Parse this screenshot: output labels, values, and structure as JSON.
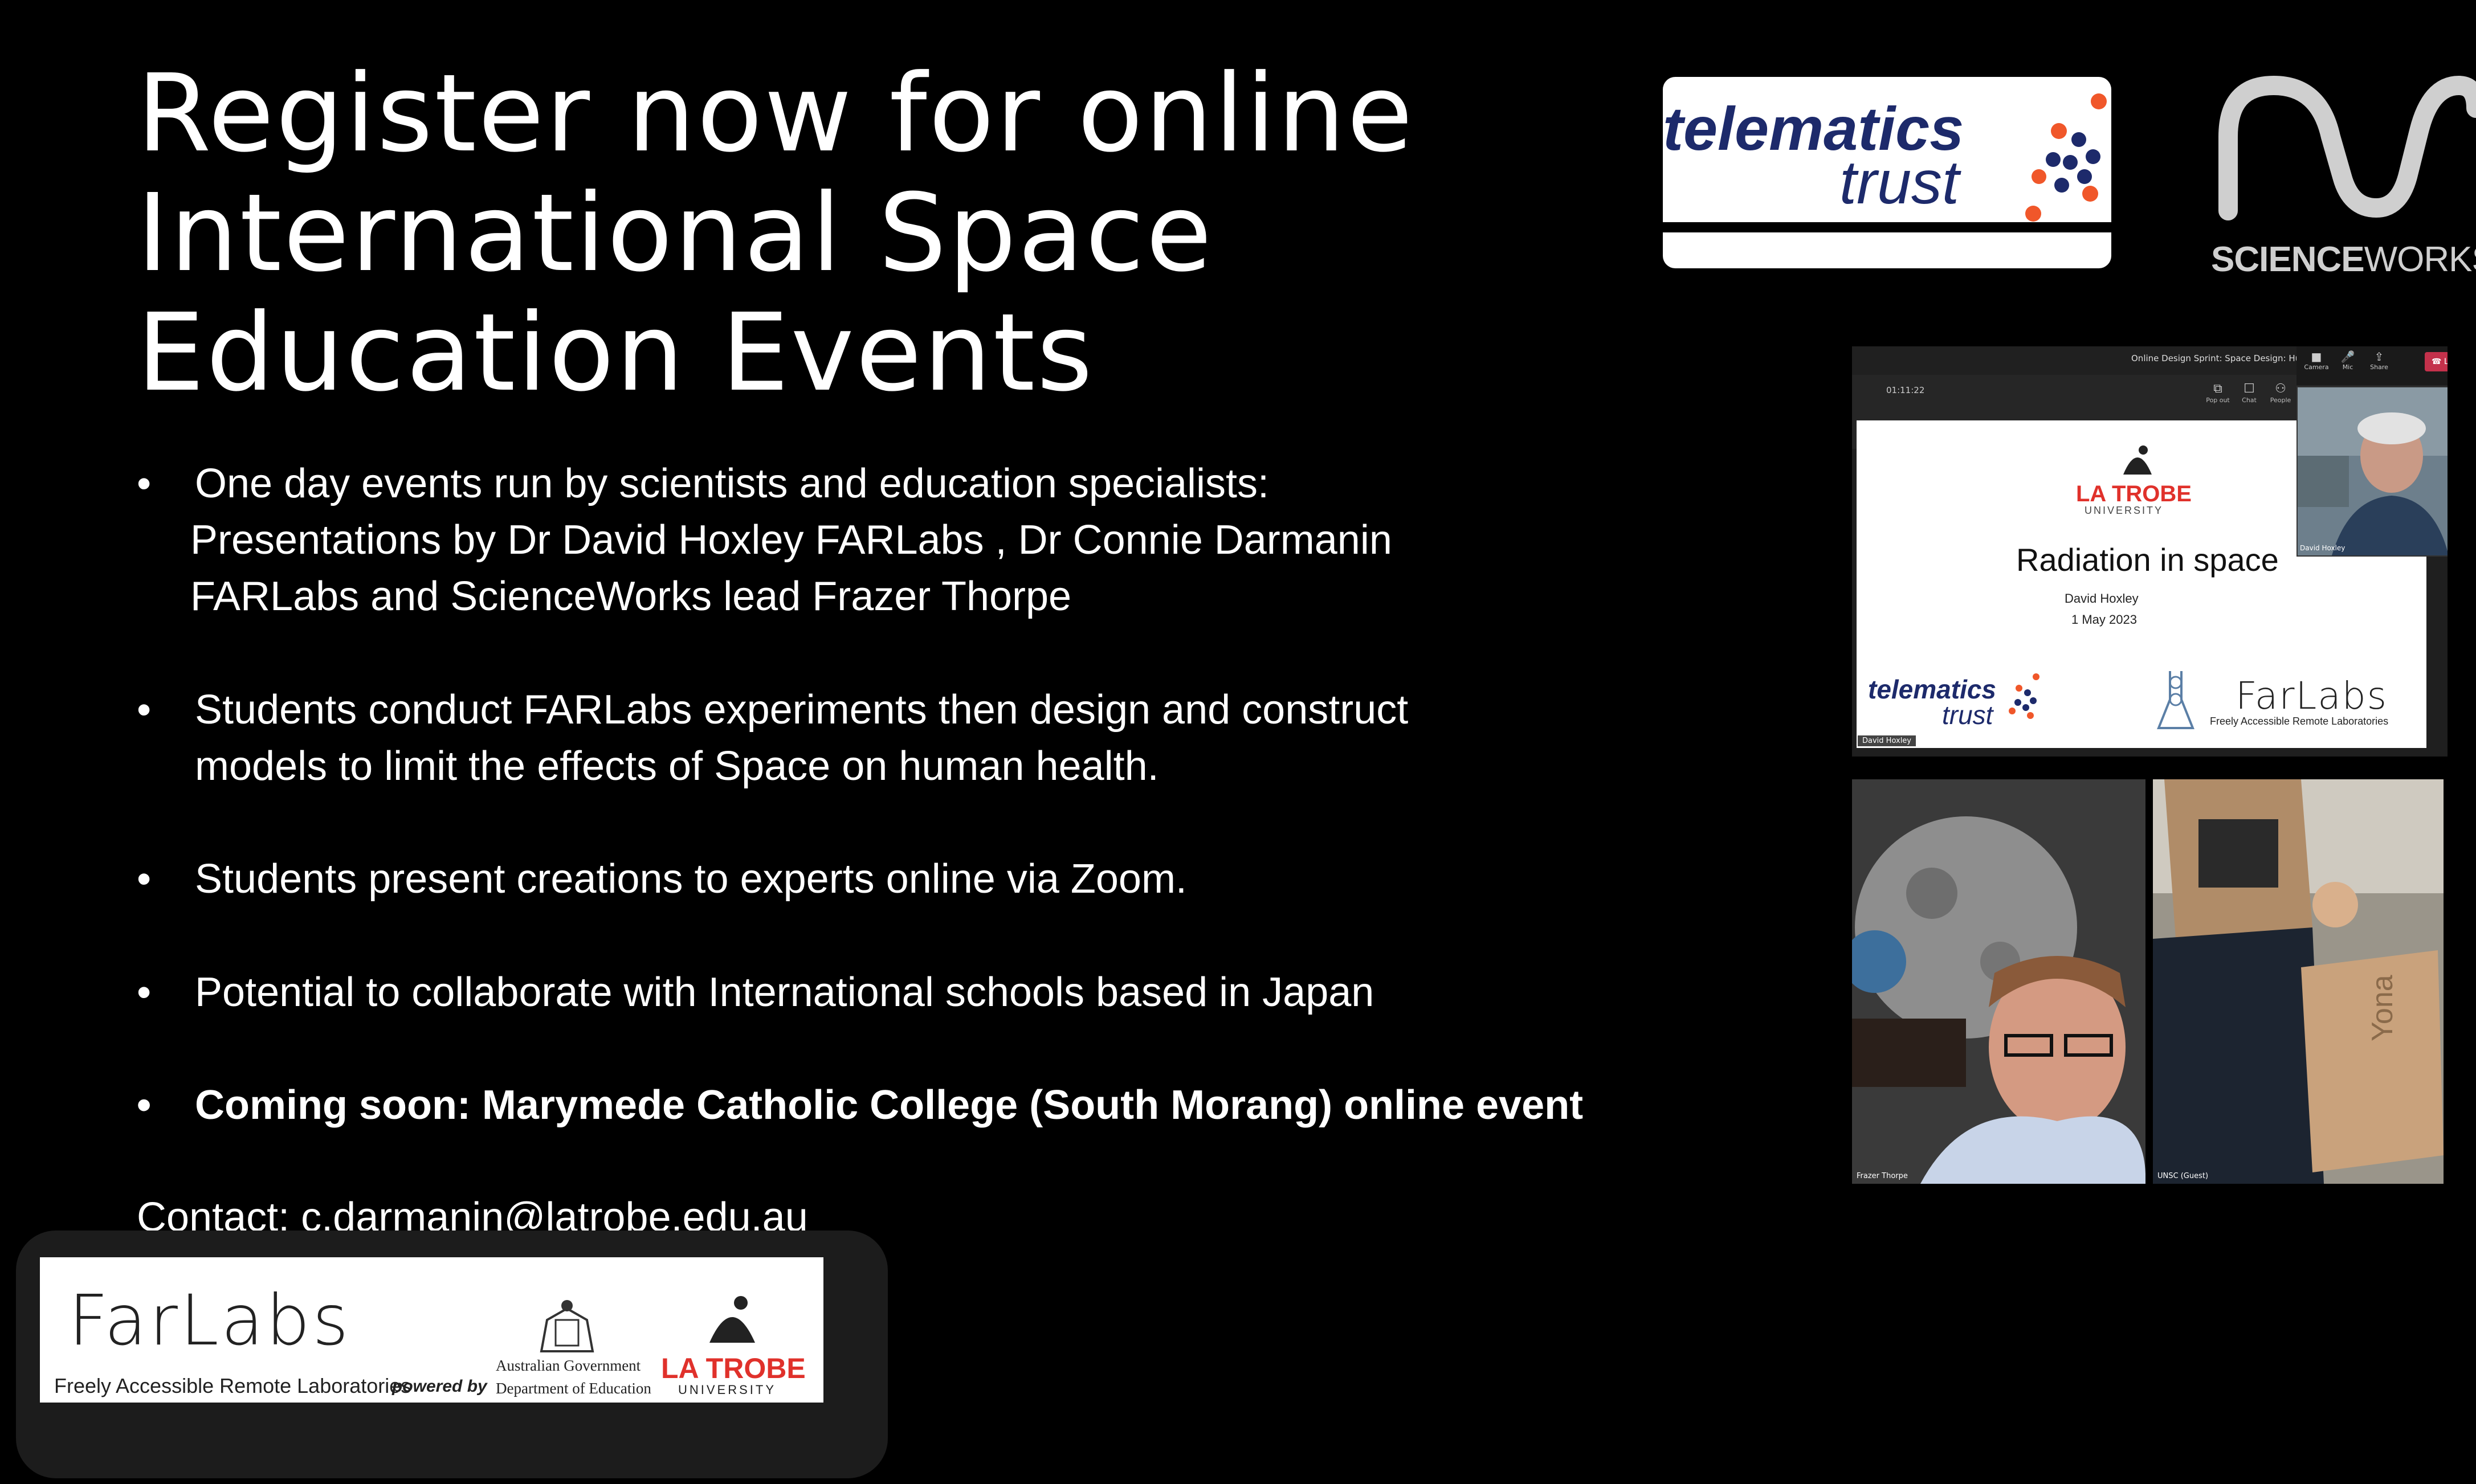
{
  "title": {
    "lines": [
      "Register now for online",
      "International Space",
      "Education Events"
    ]
  },
  "bullets": {
    "b1": {
      "lines": [
        "One day events run by scientists and education specialists:",
        "Presentations by Dr David Hoxley FARLabs , Dr Connie Darmanin",
        "FARLabs and ScienceWorks lead Frazer Thorpe"
      ]
    },
    "b2": {
      "lines": [
        "Students conduct FARLabs experiments then design and construct",
        "models to limit the effects of Space on human health."
      ]
    },
    "b3": {
      "lines": [
        "Students present creations to experts online via Zoom."
      ]
    },
    "b4": {
      "lines": [
        "Potential to collaborate with International schools based in Japan"
      ]
    },
    "b5": {
      "lines": [
        "Coming soon: Marymede Catholic College (South Morang) online event"
      ]
    },
    "bullet_symbol": "•"
  },
  "contact": "Contact: c.darmanin@latrobe.edu.au",
  "logos": {
    "telematics_word1": "telematics",
    "telematics_word2": "trust",
    "scienceworks_bold": "SCIENCE",
    "scienceworks_light": "WORKS",
    "farlabs_word": "FarLabs",
    "farlabs_sub": "Freely Accessible Remote Laboratories",
    "powered_by": "powered by",
    "aus_govt": "Australian Government",
    "aus_dept": "Department of Education",
    "latrobe_name": "LA TROBE",
    "latrobe_uni": "UNIVERSITY"
  },
  "zoom": {
    "meeting_title": "Online Design Sprint: Space Design: Human",
    "timer": "01:11:22",
    "toolbar": [
      "Pop out",
      "Chat",
      "People"
    ],
    "controls": [
      "Camera",
      "Mic",
      "Share"
    ],
    "leave": "Le",
    "slide": {
      "uni_name": "LA TROBE",
      "uni_sub": "UNIVERSITY",
      "title": "Radiation in space",
      "author": "David Hoxley",
      "date": "1 May 2023",
      "tele1": "telematics",
      "tele2": "trust",
      "farlabs": "FarLabs",
      "farlabs_sub": "Freely Accessible Remote Laboratories",
      "presenter_label": "David Hoxley"
    },
    "pip_label": "David Hoxley",
    "tile1_label": "Frazer Thorpe",
    "tile2_label": "UNSC (Guest)",
    "tile2_box_text": "Yona"
  },
  "colors": {
    "background": "#000000",
    "text": "#ffffff",
    "latrobe_red": "#e0312b",
    "telematics_navy": "#1d2a6b",
    "telematics_orange": "#f0572a"
  }
}
